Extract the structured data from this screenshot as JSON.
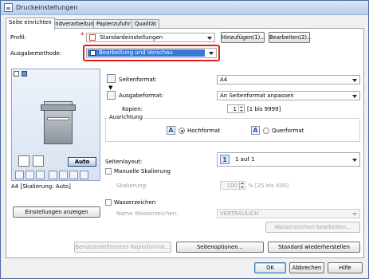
{
  "window": {
    "title": "Druckeinstellungen"
  },
  "tabs": [
    {
      "label": "Seite einrichten"
    },
    {
      "label": "Endverarbeitung"
    },
    {
      "label": "Papierzufuhr"
    },
    {
      "label": "Qualität"
    }
  ],
  "profile": {
    "label": "Profil:",
    "value": "Standardeinstellungen",
    "add_button": "Hinzufügen(1)...",
    "edit_button": "Bearbeiten(2)..."
  },
  "output_method": {
    "label": "Ausgabemethode:",
    "value": "Bearbeitung und Vorschau",
    "highlight_color": "#e0201a",
    "selected_color": "#3a78d6"
  },
  "preview": {
    "auto_label": "Auto",
    "caption": "A4 [Skalierung: Auto]",
    "show_settings_button": "Einstellungen anzeigen"
  },
  "page_size": {
    "label": "Seitenformat:",
    "value": "A4"
  },
  "output_size": {
    "label": "Ausgabeformat:",
    "value": "An Seitenformat anpassen"
  },
  "copies": {
    "label": "Kopien:",
    "value": "1",
    "range": "[1 bis 9999]"
  },
  "orientation": {
    "group_label": "Ausrichtung",
    "portrait_label": "Hochformat",
    "landscape_label": "Querformat",
    "selected": "portrait"
  },
  "layout": {
    "label": "Seitenlayout:",
    "value": "1 auf 1",
    "badge": "1"
  },
  "manual_scaling": {
    "label": "Manuelle Skalierung",
    "checked": false,
    "scaling_label": "Skalierung:",
    "value": "100",
    "unit_range": "% [25 bis 400]"
  },
  "watermark": {
    "label": "Wasserzeichen",
    "checked": false,
    "name_label": "Name Wasserzeichen:",
    "value": "VERTRAULICH",
    "edit_button": "Wasserzeichen bearbeiten..."
  },
  "bottom_buttons": {
    "custom_paper": "Benutzerdefiniertes Papierformat...",
    "page_options": "Seitenoptionen...",
    "restore_defaults": "Standard wiederherstellen"
  },
  "dialog_buttons": {
    "ok": "OK",
    "cancel": "Abbrechen",
    "help": "Hilfe"
  }
}
